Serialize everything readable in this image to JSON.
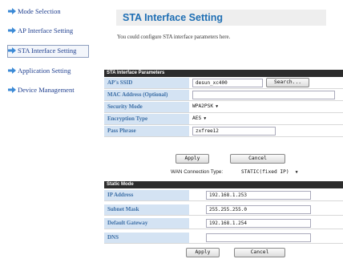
{
  "nav": {
    "items": [
      {
        "label": "Mode Selection"
      },
      {
        "label": "AP Interface Setting"
      },
      {
        "label": "STA Interface Setting",
        "active": true
      },
      {
        "label": "Application Setting"
      },
      {
        "label": "Device Management"
      }
    ],
    "arrow_color": "#3c8ad6"
  },
  "header": {
    "title": "STA Interface Setting",
    "description": "You could configure STA interface parameters here."
  },
  "sta_params": {
    "section_title": "STA Interface Parameters",
    "ssid_label": "AP's SSID",
    "ssid_value": "desun_xc400",
    "search_label": "Search...",
    "mac_label": "MAC Address (Optional)",
    "mac_value": "",
    "security_label": "Security Mode",
    "security_value": "WPA2PSK",
    "encryption_label": "Encryption Type",
    "encryption_value": "AES",
    "pass_label": "Pass Phrase",
    "pass_value": "zxfree12"
  },
  "actions1": {
    "apply": "Apply",
    "cancel": "Cancel"
  },
  "wan": {
    "label": "WAN Connection Type:",
    "value": "STATIC(fixed IP)"
  },
  "static_mode": {
    "section_title": "Static Mode",
    "ip_label": "IP Address",
    "ip_value": "192.168.1.253",
    "mask_label": "Subnet Mask",
    "mask_value": "255.255.255.0",
    "gateway_label": "Default Gateway",
    "gateway_value": "192.168.1.254",
    "dns_label": "DNS",
    "dns_value": ""
  },
  "actions2": {
    "apply": "Apply",
    "cancel": "Cancel"
  },
  "colors": {
    "label_bg": "#d4e3f3",
    "label_text": "#3b6ea6",
    "band_bg": "#2c2c2c",
    "title_text": "#1f6fb4",
    "link": "#1f3f8f"
  }
}
